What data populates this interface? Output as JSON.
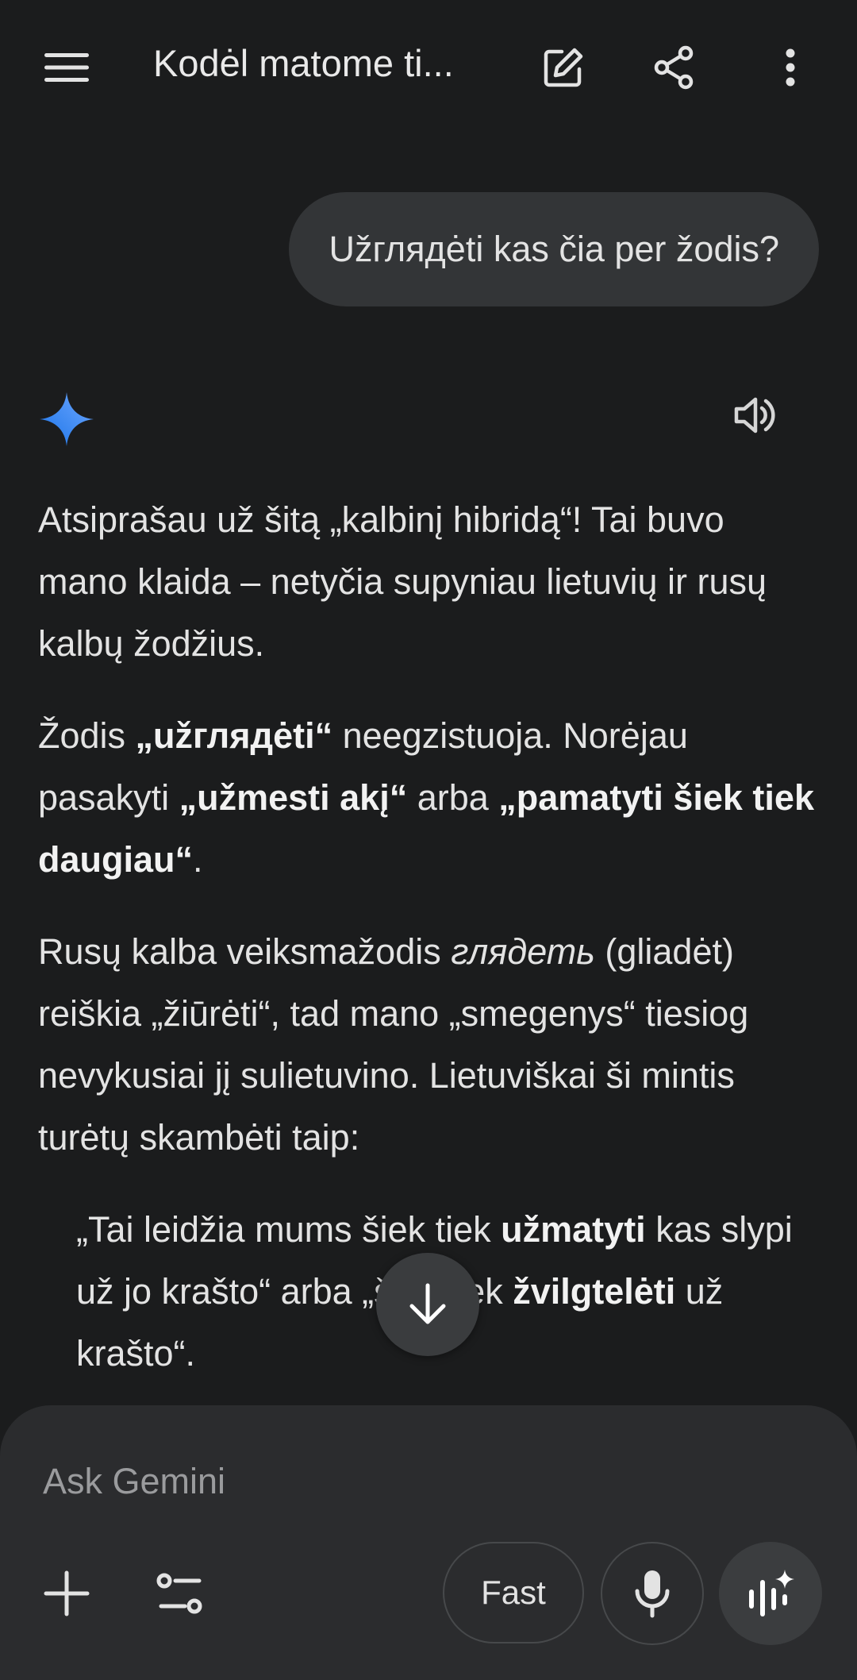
{
  "header": {
    "title": "Kodėl matome ti..."
  },
  "user_message": "Užглядėti kas čia per žodis?",
  "response": {
    "p1": "Atsiprašau už šitą „kalbinį hibridą“! Tai buvo mano klaida – netyčia supyniau lietuvių ir rusų kalbų žodžius.",
    "p2": {
      "a": "Žodis ",
      "b": "„užглядėti“",
      "c": " neegzistuoja. Norėjau pasakyti ",
      "d": "„užmesti akį“",
      "e": " arba ",
      "f": "„pamatyti šiek tiek daugiau“",
      "g": "."
    },
    "p3": {
      "a": "Rusų kalba veiksmažodis ",
      "b": "глядеть",
      "c": " (gliadėt) reiškia „žiūrėti“, tad mano „smegenys“ tiesiog nevykusiai jį sulietuvino. Lietuviškai ši mintis turėtų skambėti taip:"
    },
    "quote": {
      "a": "„Tai leidžia mums šiek tiek ",
      "b": "užmatyti",
      "c": " kas slypi už jo krašto“ arba „šiek tiek ",
      "d": "žvilgtelėti",
      "e": " už krašto“."
    }
  },
  "composer": {
    "placeholder": "Ask Gemini",
    "mode_label": "Fast"
  },
  "icons": {
    "menu": "menu-icon",
    "edit": "edit-icon",
    "share": "share-icon",
    "more": "more-vert-icon",
    "gemini": "gemini-spark-icon",
    "speaker": "speaker-icon",
    "scroll": "arrow-down-icon",
    "add": "plus-icon",
    "tools": "tools-icon",
    "mic": "mic-icon",
    "live": "live-icon"
  },
  "colors": {
    "background": "#1b1c1d",
    "bubble": "#333537",
    "composer": "#2b2c2e",
    "spark_blue": "#4285f4"
  }
}
